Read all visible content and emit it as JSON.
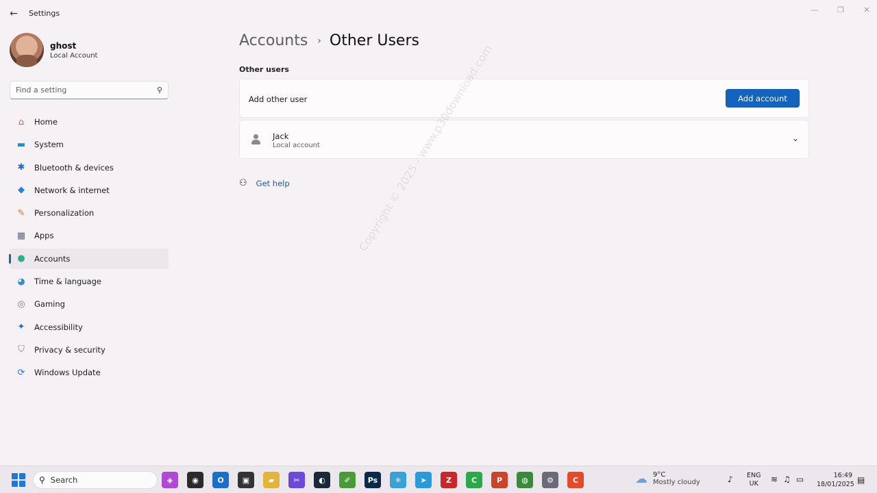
{
  "window": {
    "title": "Settings",
    "back_glyph": "←",
    "minimize_glyph": "—",
    "maximize_glyph": "❐",
    "close_glyph": "✕"
  },
  "profile": {
    "name": "ghost",
    "account_type": "Local Account"
  },
  "search": {
    "placeholder": "Find a setting",
    "icon": "search-icon",
    "glyph": "⚲"
  },
  "sidebar": {
    "items": [
      {
        "label": "Home",
        "icon": "home-icon",
        "glyph": "⌂",
        "color": "#d06a3a",
        "active": false
      },
      {
        "label": "System",
        "icon": "system-icon",
        "glyph": "▬",
        "color": "#1a8fd3",
        "active": false
      },
      {
        "label": "Bluetooth & devices",
        "icon": "bluetooth-icon",
        "glyph": "✱",
        "color": "#1a6fd3",
        "active": false
      },
      {
        "label": "Network & internet",
        "icon": "wifi-icon",
        "glyph": "◆",
        "color": "#2a7fd8",
        "active": false
      },
      {
        "label": "Personalization",
        "icon": "brush-icon",
        "glyph": "✎",
        "color": "#c9792e",
        "active": false
      },
      {
        "label": "Apps",
        "icon": "apps-icon",
        "glyph": "▦",
        "color": "#5a6a80",
        "active": false
      },
      {
        "label": "Accounts",
        "icon": "accounts-icon",
        "glyph": "●",
        "color": "#2bb08a",
        "active": true
      },
      {
        "label": "Time & language",
        "icon": "globe-clock-icon",
        "glyph": "◕",
        "color": "#2a8fd0",
        "active": false
      },
      {
        "label": "Gaming",
        "icon": "gamepad-icon",
        "glyph": "◎",
        "color": "#7a7a7a",
        "active": false
      },
      {
        "label": "Accessibility",
        "icon": "accessibility-icon",
        "glyph": "✦",
        "color": "#1a6fd3",
        "active": false
      },
      {
        "label": "Privacy & security",
        "icon": "shield-icon",
        "glyph": "⛉",
        "color": "#7a7a8a",
        "active": false
      },
      {
        "label": "Windows Update",
        "icon": "update-icon",
        "glyph": "⟳",
        "color": "#1a78d0",
        "active": false
      }
    ]
  },
  "breadcrumb": {
    "parent": "Accounts",
    "separator": "›",
    "current": "Other Users"
  },
  "other_users": {
    "section_label": "Other users",
    "add_label": "Add other user",
    "add_button": "Add account",
    "users": [
      {
        "name": "Jack",
        "type": "Local account",
        "expand_glyph": "⌄"
      }
    ]
  },
  "help": {
    "label": "Get help",
    "glyph": "⚇"
  },
  "watermark": "Copyright © 2025 - www.p30download.com",
  "taskbar": {
    "search_label": "Search",
    "search_glyph": "⚲",
    "apps": [
      {
        "name": "taskbar-app-copilot",
        "glyph": "◈",
        "color": "#b04ad6"
      },
      {
        "name": "taskbar-app-obs",
        "glyph": "◉",
        "color": "#2a2a2a"
      },
      {
        "name": "taskbar-app-outlook",
        "glyph": "O",
        "color": "#1a6fc9"
      },
      {
        "name": "taskbar-app-terminal",
        "glyph": "▣",
        "color": "#333333"
      },
      {
        "name": "taskbar-app-explorer",
        "glyph": "▰",
        "color": "#e2b43a"
      },
      {
        "name": "taskbar-app-snipping",
        "glyph": "✂",
        "color": "#6a4ad6"
      },
      {
        "name": "taskbar-app-steam",
        "glyph": "◐",
        "color": "#1b2838"
      },
      {
        "name": "taskbar-app-notepad",
        "glyph": "✐",
        "color": "#4a9a3a"
      },
      {
        "name": "taskbar-app-photoshop",
        "glyph": "Ps",
        "color": "#0b2a4a"
      },
      {
        "name": "taskbar-app-snowflake",
        "glyph": "✳",
        "color": "#3aa0d8"
      },
      {
        "name": "taskbar-app-telegram",
        "glyph": "➤",
        "color": "#2a9ad8"
      },
      {
        "name": "taskbar-app-filezilla",
        "glyph": "Z",
        "color": "#c8282a"
      },
      {
        "name": "taskbar-app-camtasia",
        "glyph": "C",
        "color": "#2aa84a"
      },
      {
        "name": "taskbar-app-powerpoint",
        "glyph": "P",
        "color": "#c8452a"
      },
      {
        "name": "taskbar-app-chrome",
        "glyph": "◍",
        "color": "#3a8a3a"
      },
      {
        "name": "taskbar-app-settings",
        "glyph": "⚙",
        "color": "#6a6a7a"
      },
      {
        "name": "taskbar-app-recorder",
        "glyph": "C",
        "color": "#e24a2a"
      }
    ],
    "weather": {
      "temp": "9°C",
      "desc": "Mostly cloudy",
      "glyph": "☁"
    },
    "mic_glyph": "♪",
    "lang_line1": "ENG",
    "lang_line2": "UK",
    "wifi_glyph": "≋",
    "volume_glyph": "♫",
    "battery_glyph": "▭",
    "time": "16:49",
    "date": "18/01/2025",
    "notif_glyph": "▤"
  }
}
